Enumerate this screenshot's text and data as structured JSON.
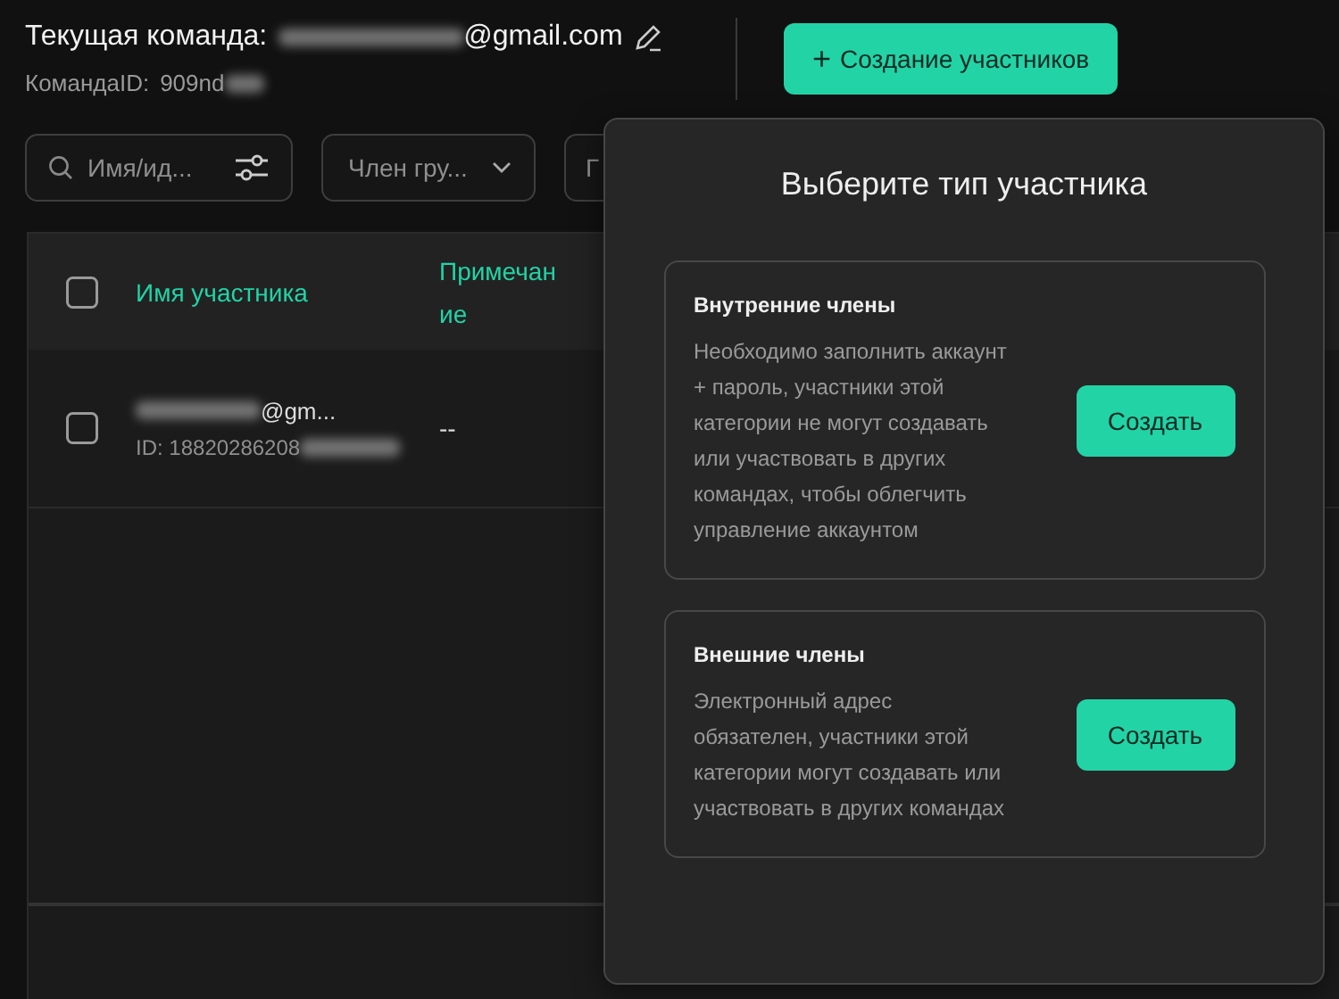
{
  "header": {
    "team_label": "Текущая команда:",
    "team_email": "@gmail.com",
    "team_id_label": "КомандаID:",
    "team_id": "909nd",
    "create_button": {
      "icon": "+",
      "label": "Создание участников"
    }
  },
  "filters": [
    {
      "kind": "search",
      "placeholder": "Имя/ид..."
    },
    {
      "kind": "dropdown",
      "value": "Член гру..."
    },
    {
      "kind": "cut",
      "value": "Г"
    }
  ],
  "table": {
    "select_all": {
      "checked": false
    },
    "columns": [
      "Имя участника",
      "Примечание"
    ],
    "rows": [
      {
        "checked": false,
        "name": "@gm...",
        "id": "ID: 18820286208",
        "note": "--"
      }
    ]
  },
  "popup": {
    "title": "Выберите тип участника",
    "options": [
      {
        "title": "Внутренние члены",
        "description": "Необходимо заполнить аккаунт + пароль, участники этой категории не могут создавать или участвовать в других командах, чтобы облегчить управление аккаунтом",
        "button": "Создать"
      },
      {
        "title": "Внешние члены",
        "description": "Электронный адрес обязателен, участники этой категории могут создавать или участвовать в других командах",
        "button": "Создать"
      }
    ]
  }
}
